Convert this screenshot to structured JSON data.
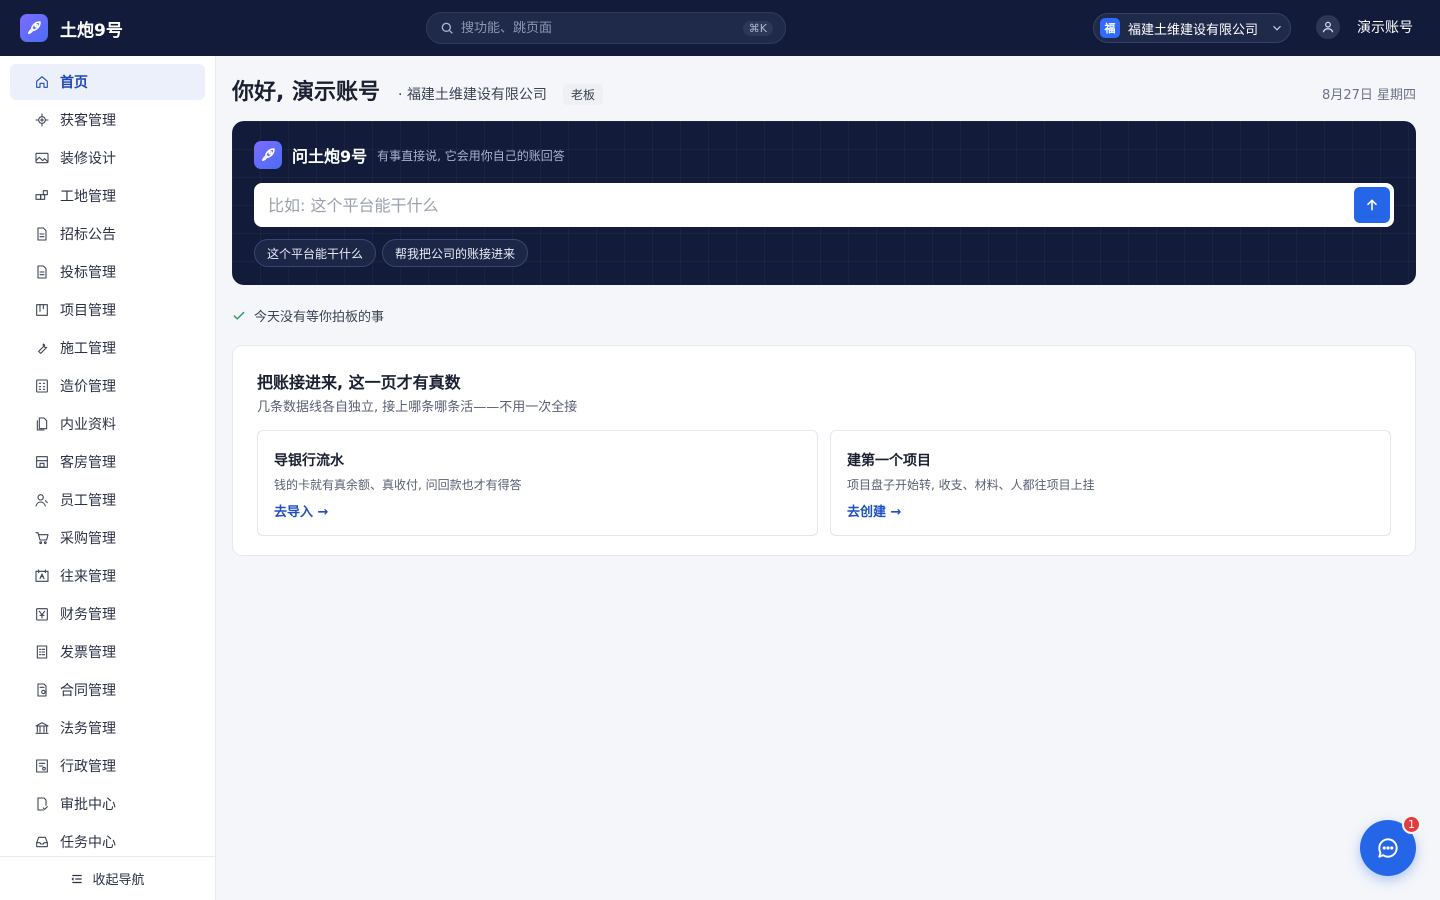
{
  "app": {
    "name": "土炮9号"
  },
  "search": {
    "placeholder": "搜功能、跳页面",
    "shortcut": "⌘K"
  },
  "org": {
    "badge": "福",
    "name": "福建土维建设有限公司"
  },
  "user": {
    "name": "演示账号"
  },
  "sidebar": {
    "items": [
      {
        "label": "首页",
        "icon": "home-icon",
        "active": true
      },
      {
        "label": "获客管理",
        "icon": "target-icon"
      },
      {
        "label": "装修设计",
        "icon": "image-icon"
      },
      {
        "label": "工地管理",
        "icon": "blocks-icon"
      },
      {
        "label": "招标公告",
        "icon": "document-icon"
      },
      {
        "label": "投标管理",
        "icon": "document-icon"
      },
      {
        "label": "项目管理",
        "icon": "kanban-icon"
      },
      {
        "label": "施工管理",
        "icon": "wrench-icon"
      },
      {
        "label": "造价管理",
        "icon": "calculator-icon"
      },
      {
        "label": "内业资料",
        "icon": "files-icon"
      },
      {
        "label": "客房管理",
        "icon": "building-icon"
      },
      {
        "label": "员工管理",
        "icon": "users-icon"
      },
      {
        "label": "采购管理",
        "icon": "cart-icon"
      },
      {
        "label": "往来管理",
        "icon": "contact-icon"
      },
      {
        "label": "财务管理",
        "icon": "yen-icon"
      },
      {
        "label": "发票管理",
        "icon": "receipt-icon"
      },
      {
        "label": "合同管理",
        "icon": "contract-icon"
      },
      {
        "label": "法务管理",
        "icon": "bank-icon"
      },
      {
        "label": "行政管理",
        "icon": "certificate-icon"
      },
      {
        "label": "审批中心",
        "icon": "approval-icon"
      },
      {
        "label": "任务中心",
        "icon": "inbox-icon"
      }
    ],
    "collapse_label": "收起导航"
  },
  "header": {
    "greeting": "你好, 演示账号",
    "org": "福建土维建设有限公司",
    "role": "老板",
    "date": "8月27日 星期四"
  },
  "ask": {
    "title": "问土炮9号",
    "subtitle": "有事直接说, 它会用你自己的账回答",
    "placeholder": "比如: 这个平台能干什么",
    "chips": [
      "这个平台能干什么",
      "帮我把公司的账接进来"
    ]
  },
  "status": {
    "text": "今天没有等你拍板的事"
  },
  "connect": {
    "title": "把账接进来, 这一页才有真数",
    "subtitle": "几条数据线各自独立, 接上哪条哪条活——不用一次全接",
    "cards": [
      {
        "title": "导银行流水",
        "desc": "钱的卡就有真余额、真收付, 问回款也才有得答",
        "link": "去导入 →"
      },
      {
        "title": "建第一个项目",
        "desc": "项目盘子开始转, 收支、材料、人都往项目上挂",
        "link": "去创建 →"
      }
    ]
  },
  "chat": {
    "badge": "1"
  },
  "colors": {
    "topbar": "#121c3a",
    "accent": "#2566e8",
    "link": "#1f4fc4"
  }
}
